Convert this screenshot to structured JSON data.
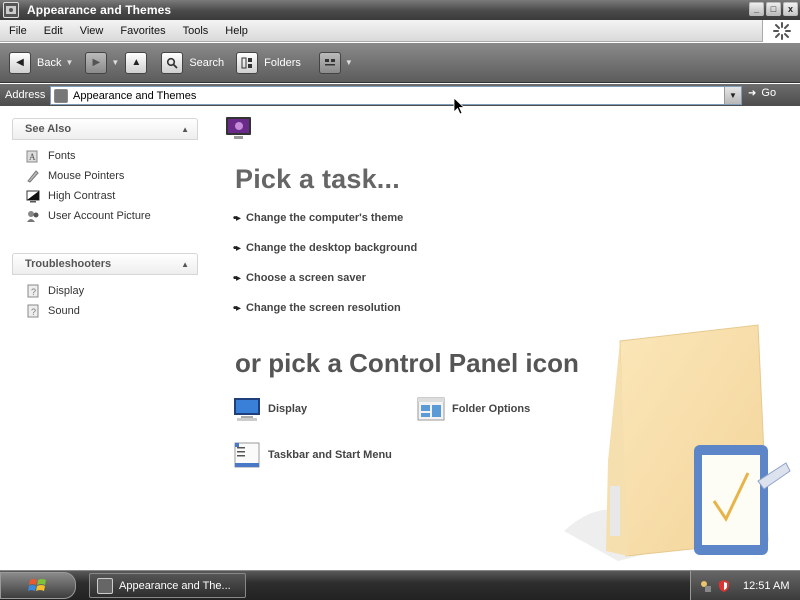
{
  "window": {
    "title": "Appearance and Themes",
    "buttons": {
      "minimize": "_",
      "maximize": "□",
      "close": "x"
    }
  },
  "menubar": {
    "items": [
      "File",
      "Edit",
      "View",
      "Favorites",
      "Tools",
      "Help"
    ]
  },
  "toolbar": {
    "back_label": "Back",
    "search_label": "Search",
    "folders_label": "Folders"
  },
  "address": {
    "label": "Address",
    "value": "Appearance and Themes",
    "go_label": "Go"
  },
  "sidebar": {
    "see_also": {
      "title": "See Also",
      "items": [
        {
          "label": "Fonts",
          "icon": "fonts-icon"
        },
        {
          "label": "Mouse Pointers",
          "icon": "mouse-pointers-icon"
        },
        {
          "label": "High Contrast",
          "icon": "high-contrast-icon"
        },
        {
          "label": "User Account Picture",
          "icon": "user-account-icon"
        }
      ]
    },
    "troubleshooters": {
      "title": "Troubleshooters",
      "items": [
        {
          "label": "Display",
          "icon": "help-icon"
        },
        {
          "label": "Sound",
          "icon": "help-icon"
        }
      ]
    }
  },
  "main": {
    "pick_task_heading": "Pick a task...",
    "tasks": [
      "Change the computer's theme",
      "Change the desktop background",
      "Choose a screen saver",
      "Change the screen resolution"
    ],
    "pick_icon_heading": "or pick a Control Panel icon",
    "icons": [
      {
        "label": "Display",
        "icon": "display-icon"
      },
      {
        "label": "Folder Options",
        "icon": "folder-options-icon"
      },
      {
        "label": "Taskbar and Start Menu",
        "icon": "taskbar-start-menu-icon"
      }
    ]
  },
  "taskbar": {
    "task_button_label": "Appearance and The...",
    "clock": "12:51 AM"
  },
  "colors": {
    "chrome_dark": "#4a4a4a",
    "heading_gray": "#666666",
    "link_text": "#444444"
  }
}
